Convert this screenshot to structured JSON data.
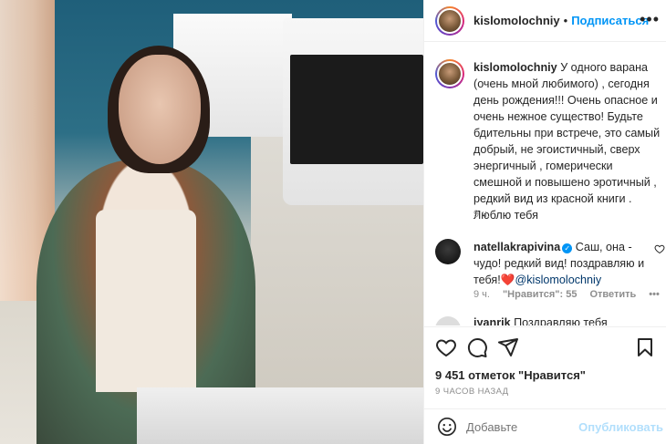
{
  "post": {
    "username": "kislomolochniy",
    "dot": "•",
    "follow_label": "Подписаться",
    "more_label": "•••"
  },
  "caption": {
    "username": "kislomolochniy",
    "text": "У одного варана (очень мной любимого) , сегодня день рождения!!! Очень опасное и очень нежное существо! Будьте бдительны при встрече, это самый добрый, не эгоистичный, сверх энергичный , гомерически смешной и повышено эротичный , редкий вид из красной книги .",
    "line2": "Люблю тебя",
    "time": "9 ч."
  },
  "comment": {
    "username": "natellakrapivina",
    "text_before": "Саш, она - чудо! редкий вид! поздравляю и тебя!",
    "heart": "❤️",
    "mention": "@kislomolochniy",
    "time": "9 ч.",
    "likes": "\"Нравится\": 55",
    "reply": "Ответить",
    "more": "•••"
  },
  "next_comment": {
    "username": "iyanrik",
    "text": "Поздравляю тебя"
  },
  "likes_label": "9 451 отметок \"Нравится\"",
  "posted_label": "9 ЧАСОВ НАЗАД",
  "add_comment": {
    "placeholder": "Добавьте",
    "publish_label": "Опубликовать"
  },
  "icons": [
    "heart-icon",
    "comment-icon",
    "share-icon",
    "bookmark-icon",
    "smile-icon"
  ],
  "colors": {
    "link": "#0095f6",
    "publish_disabled": "#b2dffc",
    "text": "#262626",
    "muted": "#8e8e8e"
  }
}
